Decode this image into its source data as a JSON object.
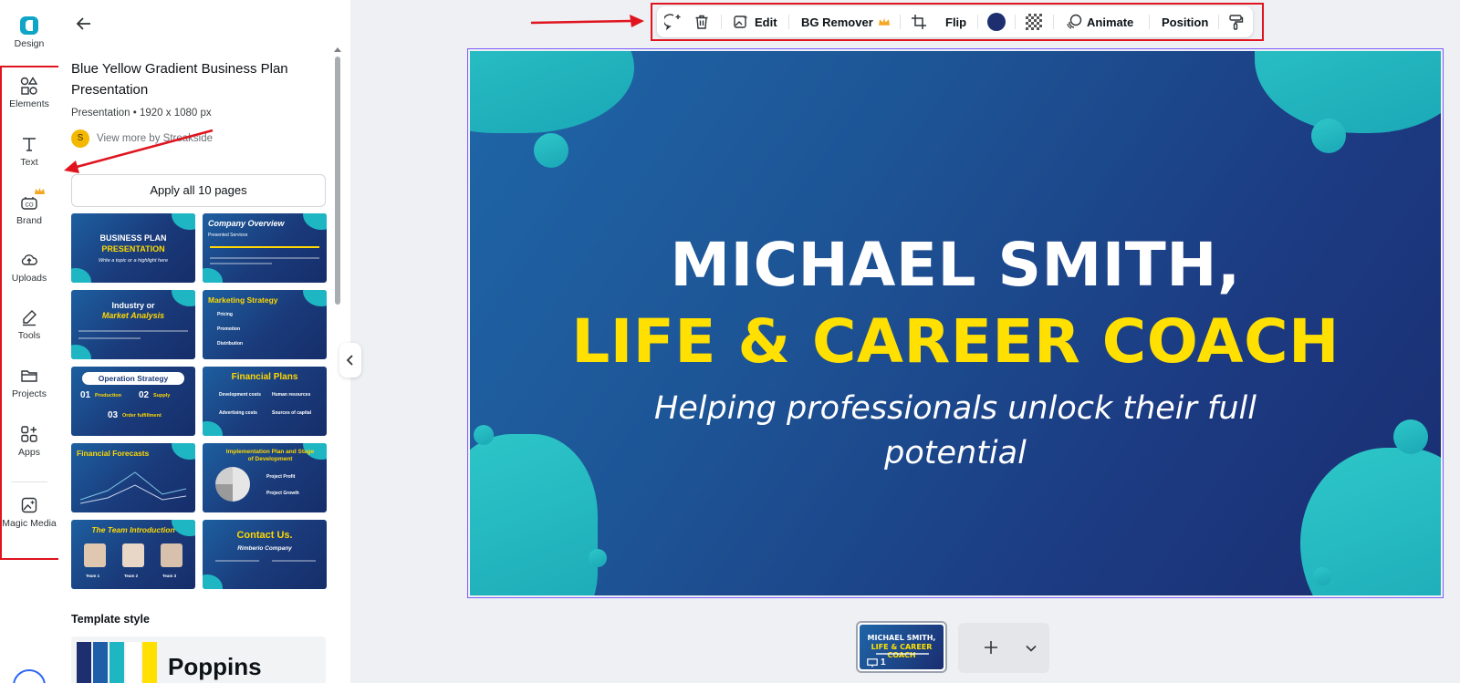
{
  "rail": {
    "items": [
      {
        "label": "Design",
        "icon": "design-logo-icon"
      },
      {
        "label": "Elements",
        "icon": "shapes-icon"
      },
      {
        "label": "Text",
        "icon": "text-icon"
      },
      {
        "label": "Brand",
        "icon": "brand-icon"
      },
      {
        "label": "Uploads",
        "icon": "cloud-upload-icon"
      },
      {
        "label": "Tools",
        "icon": "pen-tool-icon"
      },
      {
        "label": "Projects",
        "icon": "folder-icon"
      },
      {
        "label": "Apps",
        "icon": "apps-grid-icon"
      },
      {
        "label": "Magic Media",
        "icon": "magic-image-icon"
      }
    ]
  },
  "panel": {
    "title": "Blue Yellow Gradient Business Plan Presentation",
    "meta": "Presentation • 1920 x 1080 px",
    "creator_initial": "S",
    "creator_link": "View more by Streakside",
    "apply_label": "Apply all 10 pages",
    "thumbnails": [
      {
        "title": "BUSINESS PLAN",
        "subtitle": "PRESENTATION",
        "note": "Write a topic or a highlight here"
      },
      {
        "title": "Company Overview",
        "note": "Presented Services"
      },
      {
        "title": "Industry or",
        "subtitle": "Market Analysis"
      },
      {
        "title": "Marketing Strategy",
        "items": [
          "Pricing",
          "Promotion",
          "Distribution"
        ]
      },
      {
        "title": "Operation Strategy",
        "items": [
          "01",
          "Production",
          "02",
          "Supply",
          "03",
          "Order fulfillment"
        ]
      },
      {
        "title": "Financial Plans",
        "items": [
          "Development costs",
          "Human resources",
          "Advertising costs",
          "Sources of capital"
        ]
      },
      {
        "title": "Financial Forecasts"
      },
      {
        "title": "Implementation Plan and Stage of Development",
        "items": [
          "Project Profit",
          "Project Growth"
        ]
      },
      {
        "title": "The Team Introduction",
        "items": [
          "Team 1",
          "Team 2",
          "Team 3"
        ]
      },
      {
        "title": "Contact Us.",
        "subtitle": "Rimberio Company"
      }
    ],
    "template_style_title": "Template style",
    "template_font": "Poppins",
    "palette": [
      "#1d2f6f",
      "#1f5fa8",
      "#1fb6c3",
      "#ffffff",
      "#ffe000"
    ]
  },
  "toolbar": {
    "edit": "Edit",
    "bg_remover": "BG Remover",
    "flip": "Flip",
    "color": "#1d2f6f",
    "animate": "Animate",
    "position": "Position"
  },
  "slide": {
    "name_line": "MICHAEL SMITH,",
    "role_line": "LIFE & CAREER COACH",
    "tagline": "Helping professionals unlock their full potential"
  },
  "pages": {
    "current_number": "1",
    "thumb_line1": "MICHAEL SMITH,",
    "thumb_line2": "LIFE & CAREER COACH"
  },
  "colors": {
    "accent_yellow": "#ffe000",
    "teal": "#1fb6c3",
    "navy": "#1d2f6f",
    "annotation_red": "#e0141e",
    "selection_purple": "#7b5cff"
  }
}
